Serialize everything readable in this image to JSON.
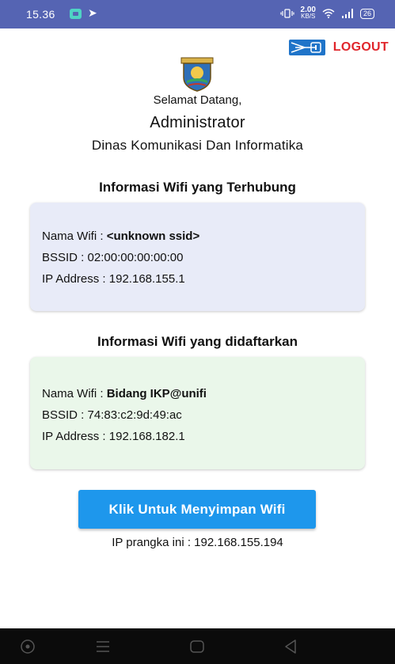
{
  "status_bar": {
    "time": "15.36",
    "net_speed_value": "2.00",
    "net_speed_unit": "KB/S",
    "battery": "26"
  },
  "header": {
    "logout_label": "LOGOUT",
    "logout_icon": "logout-icon"
  },
  "welcome": {
    "greeting": "Selamat Datang,",
    "user_role": "Administrator",
    "organization": "Dinas Komunikasi Dan Informatika"
  },
  "connected_wifi": {
    "title": "Informasi Wifi yang Terhubung",
    "name_label": "Nama Wifi : ",
    "name_value": "<unknown ssid>",
    "bssid_label": "BSSID : ",
    "bssid_value": "02:00:00:00:00:00",
    "ip_label": "IP Address : ",
    "ip_value": "192.168.155.1",
    "card_color": "#e8ebf8"
  },
  "registered_wifi": {
    "title": "Informasi Wifi yang didaftarkan",
    "name_label": "Nama Wifi : ",
    "name_value": "Bidang IKP@unifi",
    "bssid_label": "BSSID : ",
    "bssid_value": "74:83:c2:9d:49:ac",
    "ip_label": "IP Address : ",
    "ip_value": "192.168.182.1",
    "card_color": "#eaf7ea"
  },
  "actions": {
    "save_button": "Klik Untuk Menyimpan Wifi",
    "device_ip_label": "IP prangka ini : ",
    "device_ip_value": "192.168.155.194"
  },
  "colors": {
    "status_bar": "#5564b3",
    "accent_button": "#1e97ec",
    "logout_text": "#e0262b"
  }
}
